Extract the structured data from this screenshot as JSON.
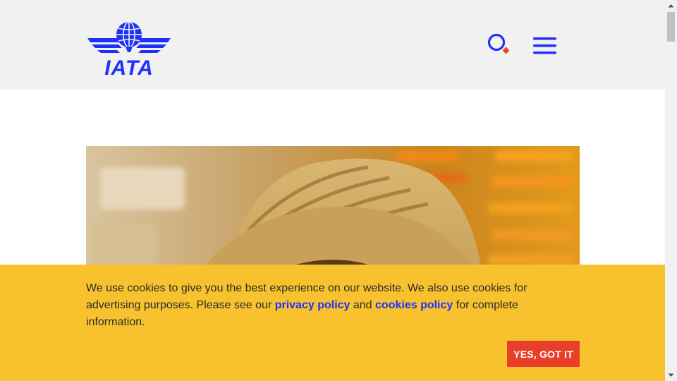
{
  "header": {
    "logo_text": "IATA",
    "logo_icon": "globe-wings-logo",
    "search_icon": "search-icon",
    "menu_icon": "hamburger-menu-icon"
  },
  "hero": {
    "image": "traveler-in-straw-hat-at-airport-photo"
  },
  "cookie_banner": {
    "text_before": "We use cookies to give you the best experience on our website. We also use cookies for advertising purposes. Please see our ",
    "privacy_link": "privacy policy",
    "text_middle": " and ",
    "cookies_link": "cookies policy",
    "text_after": " for complete information.",
    "accept_label": "YES, GOT IT"
  },
  "colors": {
    "brand_blue": "#1e32fa",
    "header_bg": "#f1f1f1",
    "banner_yellow": "#f8c22f",
    "button_red": "#e83e2a",
    "search_accent": "#e8462a"
  }
}
